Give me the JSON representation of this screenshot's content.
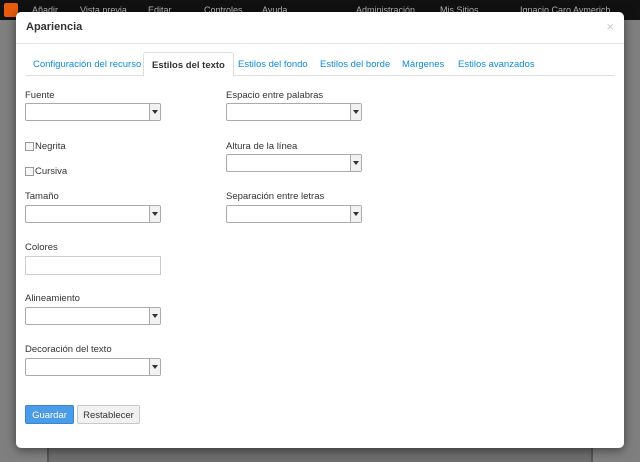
{
  "topbar": {
    "add": "Añadir",
    "view_as": "Vista previa",
    "edit": "Editar",
    "controls": "Controles",
    "help": "Ayuda",
    "admin": "Administración",
    "my_sites": "Mis Sitios",
    "user": "Ignacio Caro Aymerich"
  },
  "modal": {
    "title": "Apariencia",
    "close": "×"
  },
  "tabs": [
    {
      "label": "Configuración del recurso"
    },
    {
      "label": "Estilos del texto"
    },
    {
      "label": "Estilos del fondo"
    },
    {
      "label": "Estilos del borde"
    },
    {
      "label": "Márgenes"
    },
    {
      "label": "Estilos avanzados"
    }
  ],
  "form": {
    "font_label": "Fuente",
    "bold_label": "Negrita",
    "italic_label": "Cursiva",
    "size_label": "Tamaño",
    "colors_label": "Colores",
    "align_label": "Alineamiento",
    "decoration_label": "Decoración del texto",
    "word_spacing_label": "Espacio entre palabras",
    "line_height_label": "Altura de la línea",
    "letter_spacing_label": "Separación entre letras"
  },
  "buttons": {
    "save": "Guardar",
    "reset": "Restablecer"
  }
}
